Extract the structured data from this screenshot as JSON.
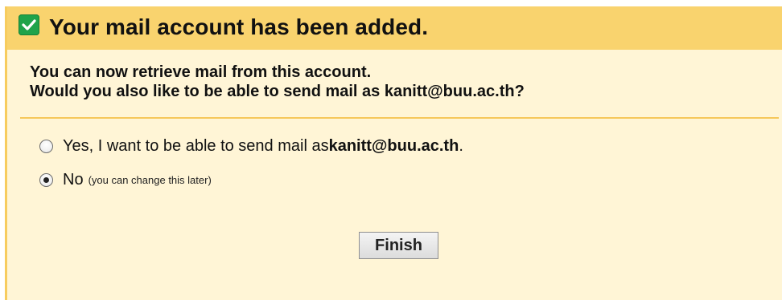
{
  "header": {
    "title": "Your mail account has been added.",
    "icon": "check-icon",
    "background": "#f9d36e"
  },
  "intro": {
    "line1": "You can now retrieve mail from this account.",
    "line2": "Would you also like to be able to send mail as kanitt@buu.ac.th?"
  },
  "options": {
    "yes": {
      "prefix": "Yes, I want to be able to send mail as ",
      "email": "kanitt@buu.ac.th",
      "suffix": ".",
      "selected": false
    },
    "no": {
      "label": "No",
      "hint": "(you can change this later)",
      "selected": true
    }
  },
  "actions": {
    "finish_label": "Finish"
  },
  "colors": {
    "panel_background": "#fff5d6",
    "accent": "#f6c75a",
    "check_green": "#1fa34a"
  }
}
